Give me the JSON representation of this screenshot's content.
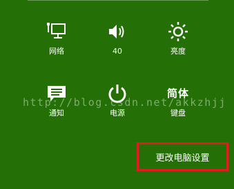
{
  "quick_settings": [
    {
      "id": "network",
      "icon": "network-icon",
      "label": "网络"
    },
    {
      "id": "volume",
      "icon": "speaker-icon",
      "label": "40"
    },
    {
      "id": "brightness",
      "icon": "brightness-icon",
      "label": "亮度"
    },
    {
      "id": "notifications",
      "icon": "notification-icon",
      "label": "通知"
    },
    {
      "id": "power",
      "icon": "power-icon",
      "label": "电源"
    },
    {
      "id": "keyboard",
      "icon": "ime-icon",
      "label": "键盘",
      "glyph": "简体"
    }
  ],
  "change_pc_settings": "更改电脑设置",
  "watermark": "http://blog.csdn.net/akkzhjj",
  "colors": {
    "background": "#246f06",
    "highlight_border": "#e21c1c"
  }
}
